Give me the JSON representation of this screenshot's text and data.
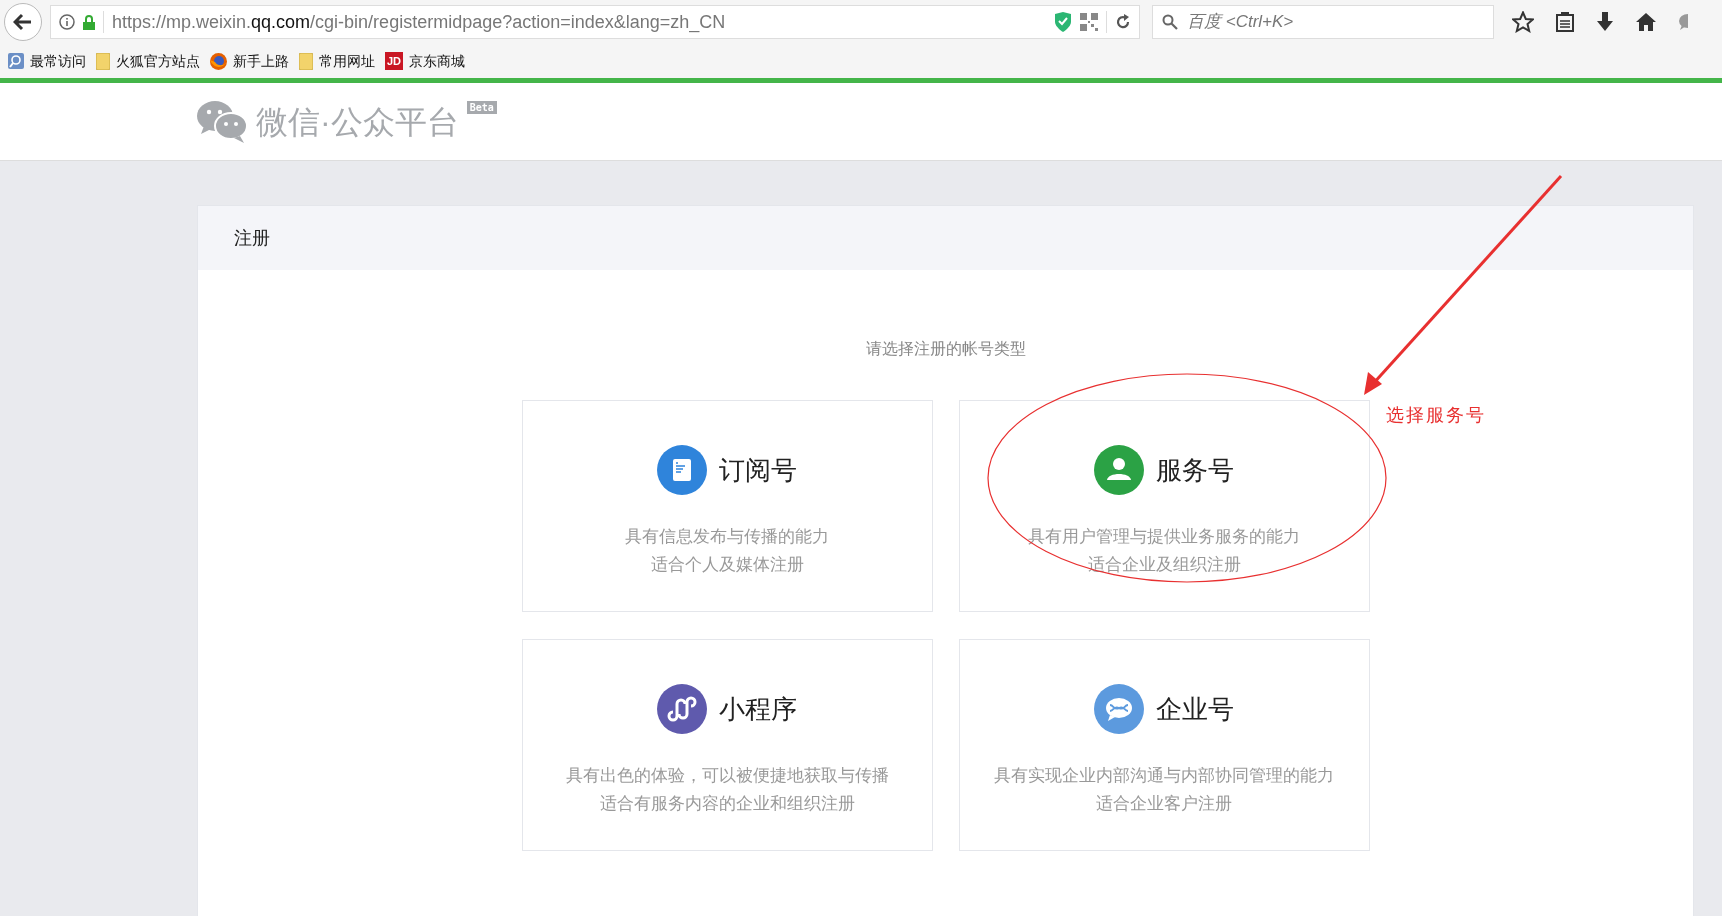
{
  "browser": {
    "url": {
      "prefix": "https://mp.weixin.",
      "domain": "qq.com",
      "path": "/cgi-bin/registermidpage?action=index&lang=zh_CN"
    },
    "search": {
      "placeholder": "百度 <Ctrl+K>"
    },
    "bookmarks": [
      {
        "kind": "search",
        "label": "最常访问"
      },
      {
        "kind": "folder",
        "label": "火狐官方站点"
      },
      {
        "kind": "firefox",
        "label": "新手上路"
      },
      {
        "kind": "folder",
        "label": "常用网址"
      },
      {
        "kind": "jd",
        "label": "京东商城",
        "badge": "JD"
      }
    ]
  },
  "header": {
    "logo_text": "微信·公众平台",
    "badge": "Beta"
  },
  "panel": {
    "title": "注册",
    "subtitle": "请选择注册的帐号类型",
    "cards": [
      {
        "kind": "subscription",
        "title": "订阅号",
        "lines": [
          "具有信息发布与传播的能力",
          "适合个人及媒体注册"
        ]
      },
      {
        "kind": "service",
        "title": "服务号",
        "lines": [
          "具有用户管理与提供业务服务的能力",
          "适合企业及组织注册"
        ]
      },
      {
        "kind": "miniprogram",
        "title": "小程序",
        "lines": [
          "具有出色的体验，可以被便捷地获取与传播",
          "适合有服务内容的企业和组织注册"
        ]
      },
      {
        "kind": "enterprise",
        "title": "企业号",
        "lines": [
          "具有实现企业内部沟通与内部协同管理的能力",
          "适合企业客户注册"
        ]
      }
    ]
  },
  "annotation": {
    "label": "选择服务号"
  }
}
